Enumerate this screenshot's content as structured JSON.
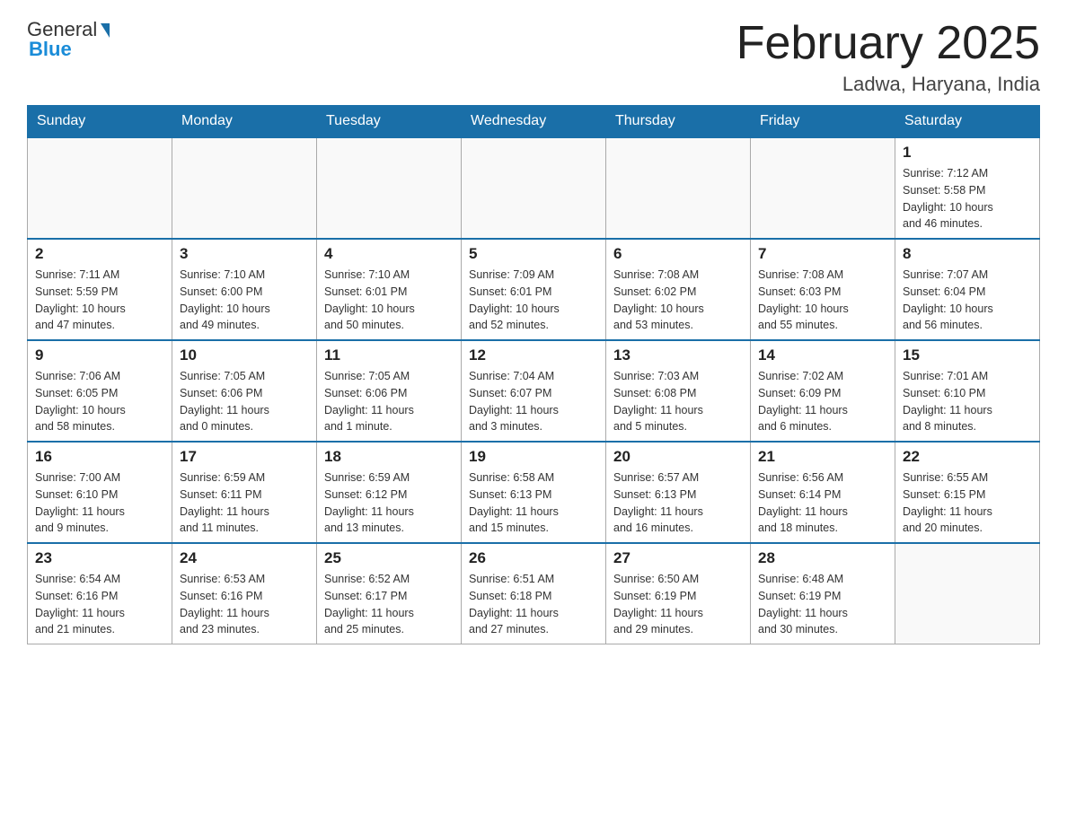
{
  "header": {
    "logo_general": "General",
    "logo_blue": "Blue",
    "month_title": "February 2025",
    "location": "Ladwa, Haryana, India"
  },
  "days_of_week": [
    "Sunday",
    "Monday",
    "Tuesday",
    "Wednesday",
    "Thursday",
    "Friday",
    "Saturday"
  ],
  "weeks": [
    [
      {
        "day": "",
        "info": ""
      },
      {
        "day": "",
        "info": ""
      },
      {
        "day": "",
        "info": ""
      },
      {
        "day": "",
        "info": ""
      },
      {
        "day": "",
        "info": ""
      },
      {
        "day": "",
        "info": ""
      },
      {
        "day": "1",
        "info": "Sunrise: 7:12 AM\nSunset: 5:58 PM\nDaylight: 10 hours\nand 46 minutes."
      }
    ],
    [
      {
        "day": "2",
        "info": "Sunrise: 7:11 AM\nSunset: 5:59 PM\nDaylight: 10 hours\nand 47 minutes."
      },
      {
        "day": "3",
        "info": "Sunrise: 7:10 AM\nSunset: 6:00 PM\nDaylight: 10 hours\nand 49 minutes."
      },
      {
        "day": "4",
        "info": "Sunrise: 7:10 AM\nSunset: 6:01 PM\nDaylight: 10 hours\nand 50 minutes."
      },
      {
        "day": "5",
        "info": "Sunrise: 7:09 AM\nSunset: 6:01 PM\nDaylight: 10 hours\nand 52 minutes."
      },
      {
        "day": "6",
        "info": "Sunrise: 7:08 AM\nSunset: 6:02 PM\nDaylight: 10 hours\nand 53 minutes."
      },
      {
        "day": "7",
        "info": "Sunrise: 7:08 AM\nSunset: 6:03 PM\nDaylight: 10 hours\nand 55 minutes."
      },
      {
        "day": "8",
        "info": "Sunrise: 7:07 AM\nSunset: 6:04 PM\nDaylight: 10 hours\nand 56 minutes."
      }
    ],
    [
      {
        "day": "9",
        "info": "Sunrise: 7:06 AM\nSunset: 6:05 PM\nDaylight: 10 hours\nand 58 minutes."
      },
      {
        "day": "10",
        "info": "Sunrise: 7:05 AM\nSunset: 6:06 PM\nDaylight: 11 hours\nand 0 minutes."
      },
      {
        "day": "11",
        "info": "Sunrise: 7:05 AM\nSunset: 6:06 PM\nDaylight: 11 hours\nand 1 minute."
      },
      {
        "day": "12",
        "info": "Sunrise: 7:04 AM\nSunset: 6:07 PM\nDaylight: 11 hours\nand 3 minutes."
      },
      {
        "day": "13",
        "info": "Sunrise: 7:03 AM\nSunset: 6:08 PM\nDaylight: 11 hours\nand 5 minutes."
      },
      {
        "day": "14",
        "info": "Sunrise: 7:02 AM\nSunset: 6:09 PM\nDaylight: 11 hours\nand 6 minutes."
      },
      {
        "day": "15",
        "info": "Sunrise: 7:01 AM\nSunset: 6:10 PM\nDaylight: 11 hours\nand 8 minutes."
      }
    ],
    [
      {
        "day": "16",
        "info": "Sunrise: 7:00 AM\nSunset: 6:10 PM\nDaylight: 11 hours\nand 9 minutes."
      },
      {
        "day": "17",
        "info": "Sunrise: 6:59 AM\nSunset: 6:11 PM\nDaylight: 11 hours\nand 11 minutes."
      },
      {
        "day": "18",
        "info": "Sunrise: 6:59 AM\nSunset: 6:12 PM\nDaylight: 11 hours\nand 13 minutes."
      },
      {
        "day": "19",
        "info": "Sunrise: 6:58 AM\nSunset: 6:13 PM\nDaylight: 11 hours\nand 15 minutes."
      },
      {
        "day": "20",
        "info": "Sunrise: 6:57 AM\nSunset: 6:13 PM\nDaylight: 11 hours\nand 16 minutes."
      },
      {
        "day": "21",
        "info": "Sunrise: 6:56 AM\nSunset: 6:14 PM\nDaylight: 11 hours\nand 18 minutes."
      },
      {
        "day": "22",
        "info": "Sunrise: 6:55 AM\nSunset: 6:15 PM\nDaylight: 11 hours\nand 20 minutes."
      }
    ],
    [
      {
        "day": "23",
        "info": "Sunrise: 6:54 AM\nSunset: 6:16 PM\nDaylight: 11 hours\nand 21 minutes."
      },
      {
        "day": "24",
        "info": "Sunrise: 6:53 AM\nSunset: 6:16 PM\nDaylight: 11 hours\nand 23 minutes."
      },
      {
        "day": "25",
        "info": "Sunrise: 6:52 AM\nSunset: 6:17 PM\nDaylight: 11 hours\nand 25 minutes."
      },
      {
        "day": "26",
        "info": "Sunrise: 6:51 AM\nSunset: 6:18 PM\nDaylight: 11 hours\nand 27 minutes."
      },
      {
        "day": "27",
        "info": "Sunrise: 6:50 AM\nSunset: 6:19 PM\nDaylight: 11 hours\nand 29 minutes."
      },
      {
        "day": "28",
        "info": "Sunrise: 6:48 AM\nSunset: 6:19 PM\nDaylight: 11 hours\nand 30 minutes."
      },
      {
        "day": "",
        "info": ""
      }
    ]
  ]
}
